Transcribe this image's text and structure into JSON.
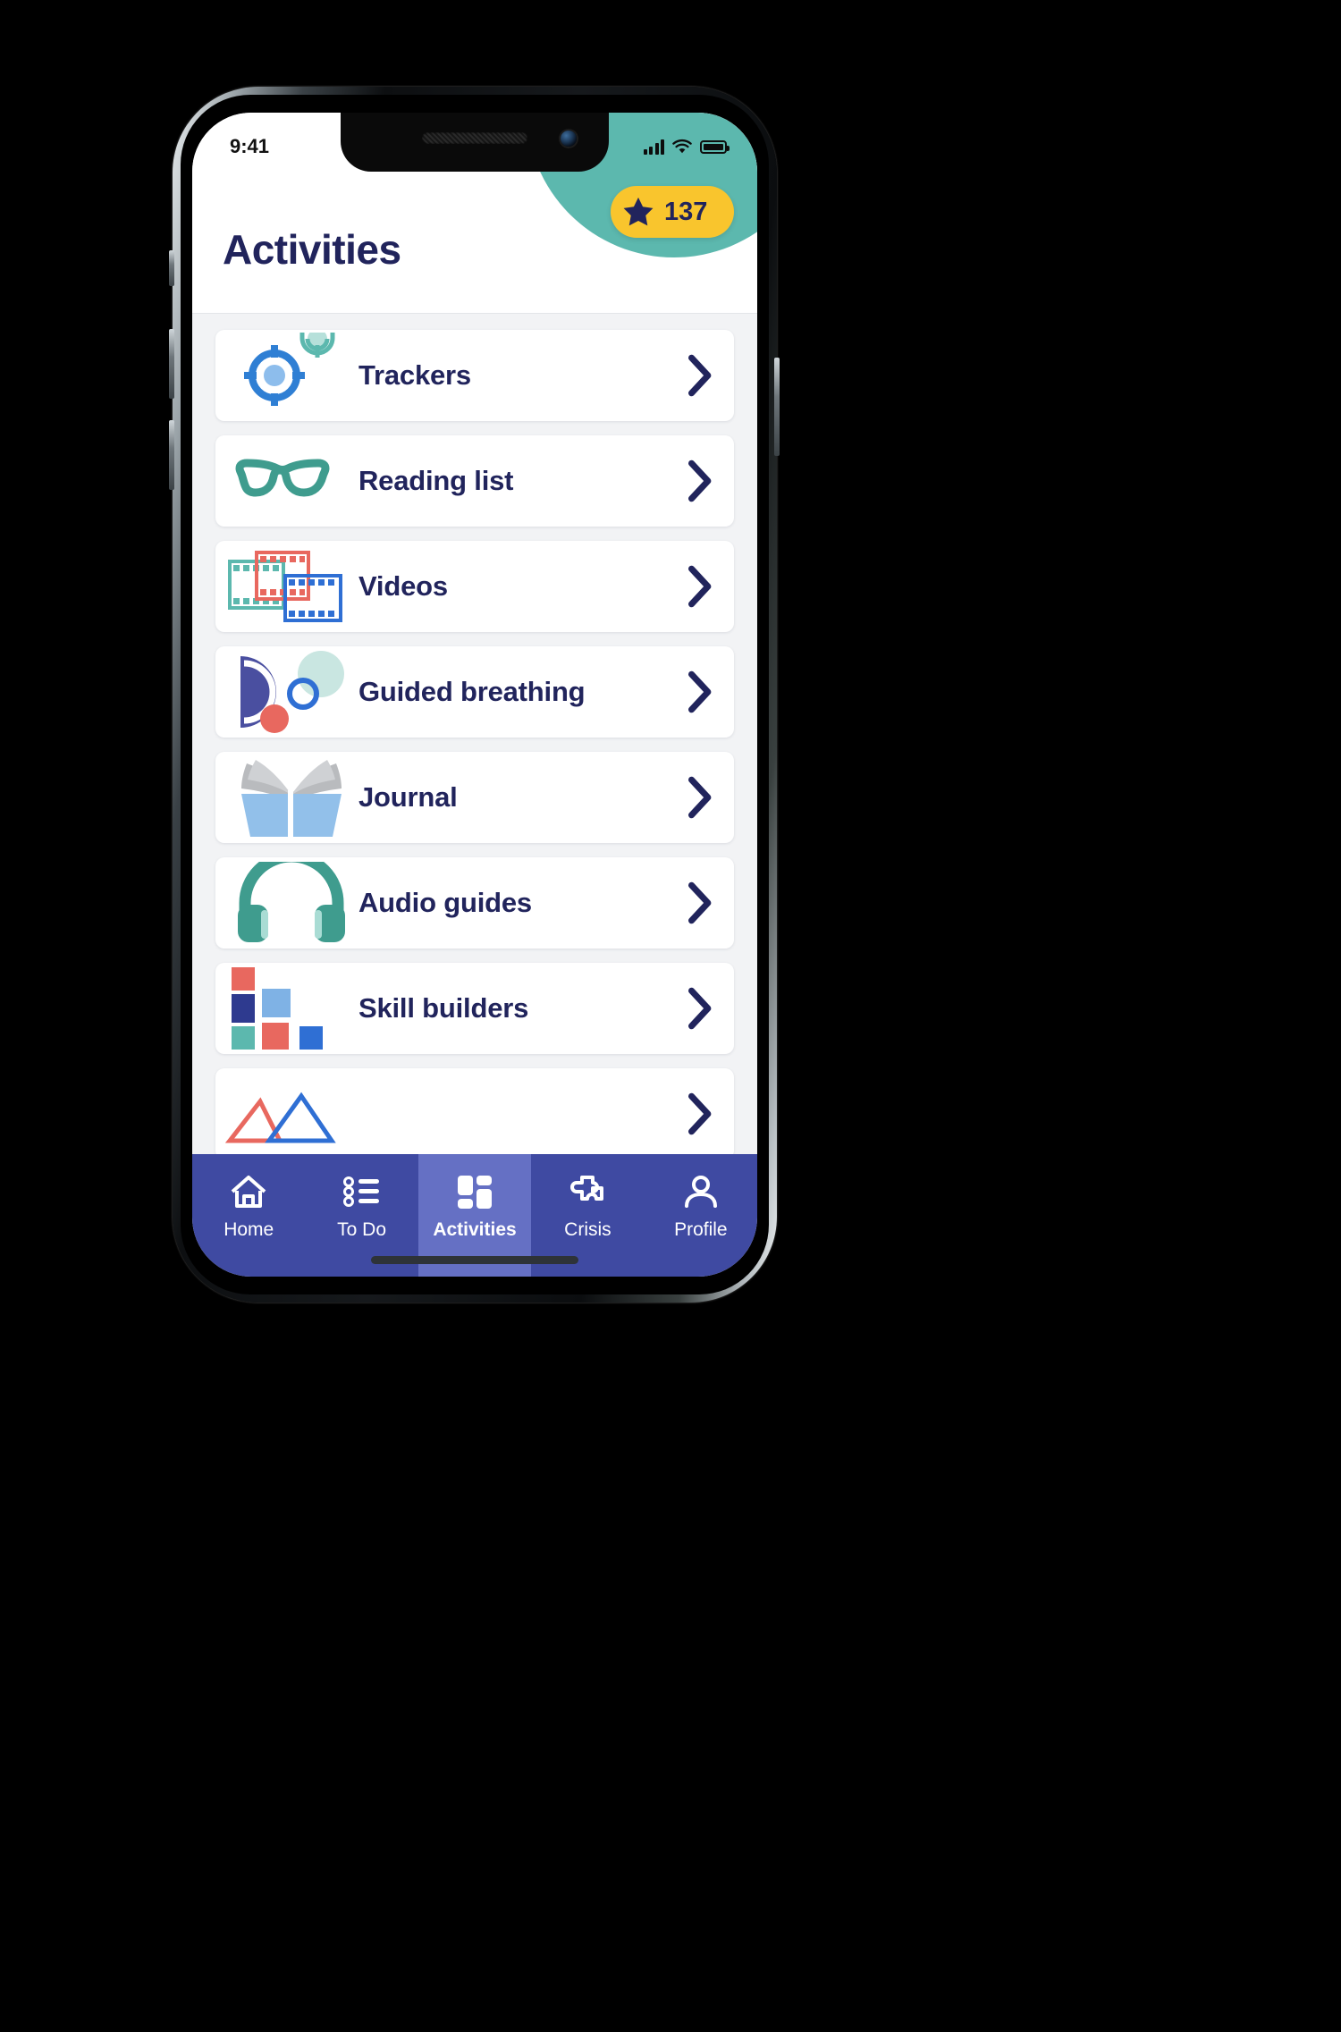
{
  "status_bar": {
    "time": "9:41",
    "signal_icon": "cellular-bars-icon",
    "wifi_icon": "wifi-icon",
    "battery_icon": "battery-full-icon"
  },
  "header": {
    "title": "Activities",
    "points_badge": {
      "star_icon": "star-icon",
      "value": "137",
      "background_color": "#f9c52d",
      "text_color": "#21245c"
    },
    "decoration_color": "#5cb8ae"
  },
  "theme": {
    "title_color": "#21245c",
    "list_background": "#f2f3f5",
    "card_background": "#ffffff",
    "nav_background": "#3f4aa2",
    "nav_active_background": "#6570c4",
    "chevron_color": "#21245c"
  },
  "activities": {
    "items": [
      {
        "label": "Trackers",
        "icon": "target-tracker-icon",
        "chevron": "chevron-right-icon"
      },
      {
        "label": "Reading list",
        "icon": "glasses-icon",
        "chevron": "chevron-right-icon"
      },
      {
        "label": "Videos",
        "icon": "film-strip-icon",
        "chevron": "chevron-right-icon"
      },
      {
        "label": "Guided breathing",
        "icon": "breathing-circles-icon",
        "chevron": "chevron-right-icon"
      },
      {
        "label": "Journal",
        "icon": "open-book-icon",
        "chevron": "chevron-right-icon"
      },
      {
        "label": "Audio guides",
        "icon": "headphones-icon",
        "chevron": "chevron-right-icon"
      },
      {
        "label": "Skill builders",
        "icon": "blocks-grid-icon",
        "chevron": "chevron-right-icon"
      }
    ]
  },
  "bottom_nav": {
    "items": [
      {
        "label": "Home",
        "icon": "home-icon",
        "active": false
      },
      {
        "label": "To Do",
        "icon": "checklist-icon",
        "active": false
      },
      {
        "label": "Activities",
        "icon": "grid-icon",
        "active": true
      },
      {
        "label": "Crisis",
        "icon": "puzzle-icon",
        "active": false
      },
      {
        "label": "Profile",
        "icon": "person-icon",
        "active": false
      }
    ]
  }
}
